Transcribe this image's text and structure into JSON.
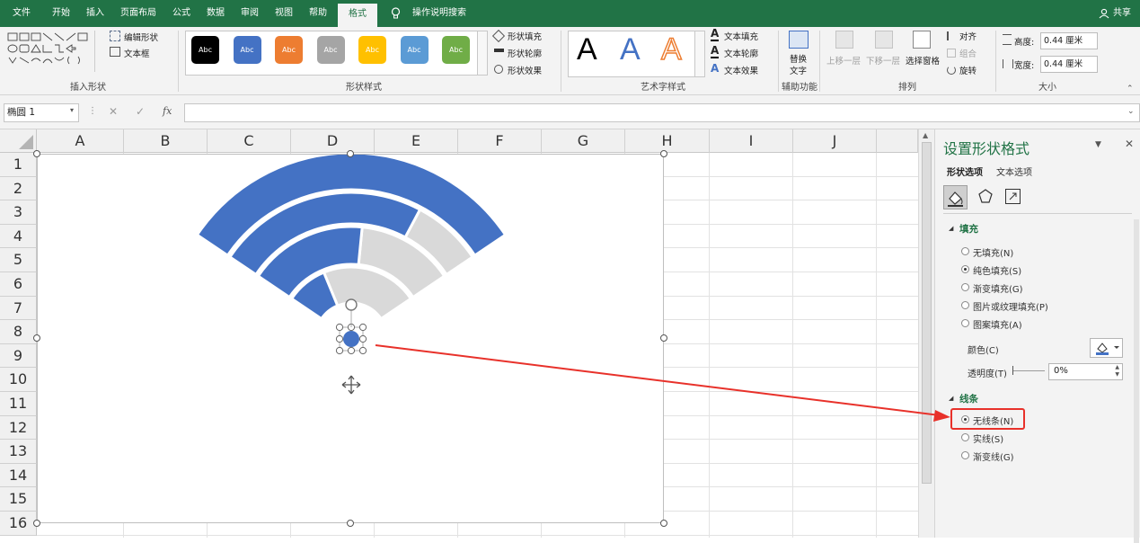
{
  "menu": {
    "tabs": [
      "文件",
      "开始",
      "插入",
      "页面布局",
      "公式",
      "数据",
      "审阅",
      "视图",
      "帮助",
      "格式"
    ],
    "tell_me": "操作说明搜索",
    "share": "共享"
  },
  "ribbon": {
    "insert_shapes": {
      "edit_shape": "编辑形状",
      "text_box": "文本框",
      "label": "插入形状"
    },
    "shape_styles": {
      "swatch_text": "Abc",
      "fill": "形状填充",
      "outline": "形状轮廓",
      "effects": "形状效果",
      "label": "形状样式",
      "swatches": [
        "#000000",
        "#4472c4",
        "#ed7d31",
        "#a5a5a5",
        "#ffc000",
        "#5b9bd5",
        "#70ad47"
      ]
    },
    "wordart": {
      "glyph": "A",
      "text_fill": "文本填充",
      "text_outline": "文本轮廓",
      "text_effects": "文本效果",
      "label": "艺术字样式"
    },
    "accessibility": {
      "alt_text_1": "替换",
      "alt_text_2": "文字",
      "label": "辅助功能"
    },
    "arrange": {
      "bring_forward": "上移一层",
      "send_backward": "下移一层",
      "selection_pane": "选择窗格",
      "align": "对齐",
      "group": "组合",
      "rotate": "旋转",
      "label": "排列"
    },
    "size": {
      "height_label": "高度:",
      "height_value": "0.44 厘米",
      "width_label": "宽度:",
      "width_value": "0.44 厘米",
      "label": "大小"
    }
  },
  "formula_bar": {
    "name_box": "椭圆 1",
    "fx": "fx",
    "value": ""
  },
  "sheet": {
    "columns": [
      "A",
      "B",
      "C",
      "D",
      "E",
      "F",
      "G",
      "H",
      "I",
      "J"
    ],
    "rows": [
      "1",
      "2",
      "3",
      "4",
      "5",
      "6",
      "7",
      "8",
      "9",
      "10",
      "11",
      "12",
      "13",
      "14",
      "15",
      "16"
    ]
  },
  "chart": {
    "arc_blue": "#4472c4",
    "arc_gray": "#d9d9d9",
    "fill_fractions": [
      1.0,
      0.75,
      0.55,
      0.3
    ]
  },
  "format_pane": {
    "title": "设置形状格式",
    "tab_shape": "形状选项",
    "tab_text": "文本选项",
    "fill_section": "填充",
    "fill_options": [
      "无填充(N)",
      "纯色填充(S)",
      "渐变填充(G)",
      "图片或纹理填充(P)",
      "图案填充(A)"
    ],
    "fill_selected_index": 1,
    "color_label": "颜色(C)",
    "transparency_label": "透明度(T)",
    "transparency_value": "0%",
    "line_section": "线条",
    "line_options": [
      "无线条(N)",
      "实线(S)",
      "渐变线(G)"
    ],
    "line_selected_index": 0,
    "accent": "#e8312a"
  }
}
